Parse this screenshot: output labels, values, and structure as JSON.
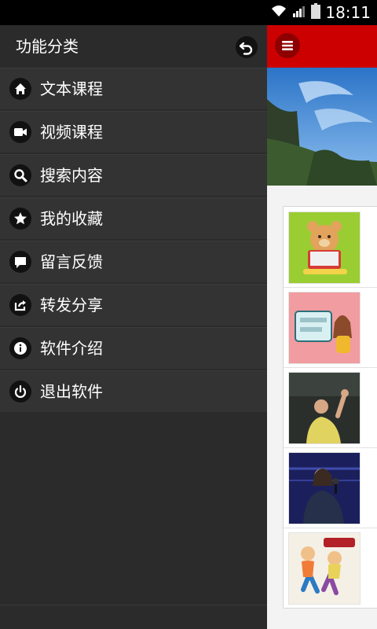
{
  "status_bar": {
    "time": "18:11",
    "icons": [
      "wifi-icon",
      "signal-icon",
      "battery-icon"
    ]
  },
  "drawer": {
    "title": "功能分类",
    "back_icon": "back-arrow-icon",
    "items": [
      {
        "label": "文本课程",
        "icon": "home-icon"
      },
      {
        "label": "视频课程",
        "icon": "video-camera-icon"
      },
      {
        "label": "搜索内容",
        "icon": "search-icon"
      },
      {
        "label": "我的收藏",
        "icon": "star-icon"
      },
      {
        "label": "留言反馈",
        "icon": "speech-bubble-icon"
      },
      {
        "label": "转发分享",
        "icon": "share-icon"
      },
      {
        "label": "软件介绍",
        "icon": "info-icon"
      },
      {
        "label": "退出软件",
        "icon": "power-icon"
      }
    ]
  },
  "main": {
    "accent": "#cc0000",
    "menu_icon": "hamburger-icon",
    "thumbnails": [
      {
        "name": "bear-reading-thumbnail",
        "overlay_text": ""
      },
      {
        "name": "spoken-chinese-cover-thumbnail",
        "overlay_text": ""
      },
      {
        "name": "teacher-waving-thumbnail",
        "overlay_text": ""
      },
      {
        "name": "singer-on-stage-thumbnail",
        "overlay_text": ""
      },
      {
        "name": "grammar-cartoon-thumbnail",
        "overlay_text": ""
      }
    ]
  }
}
